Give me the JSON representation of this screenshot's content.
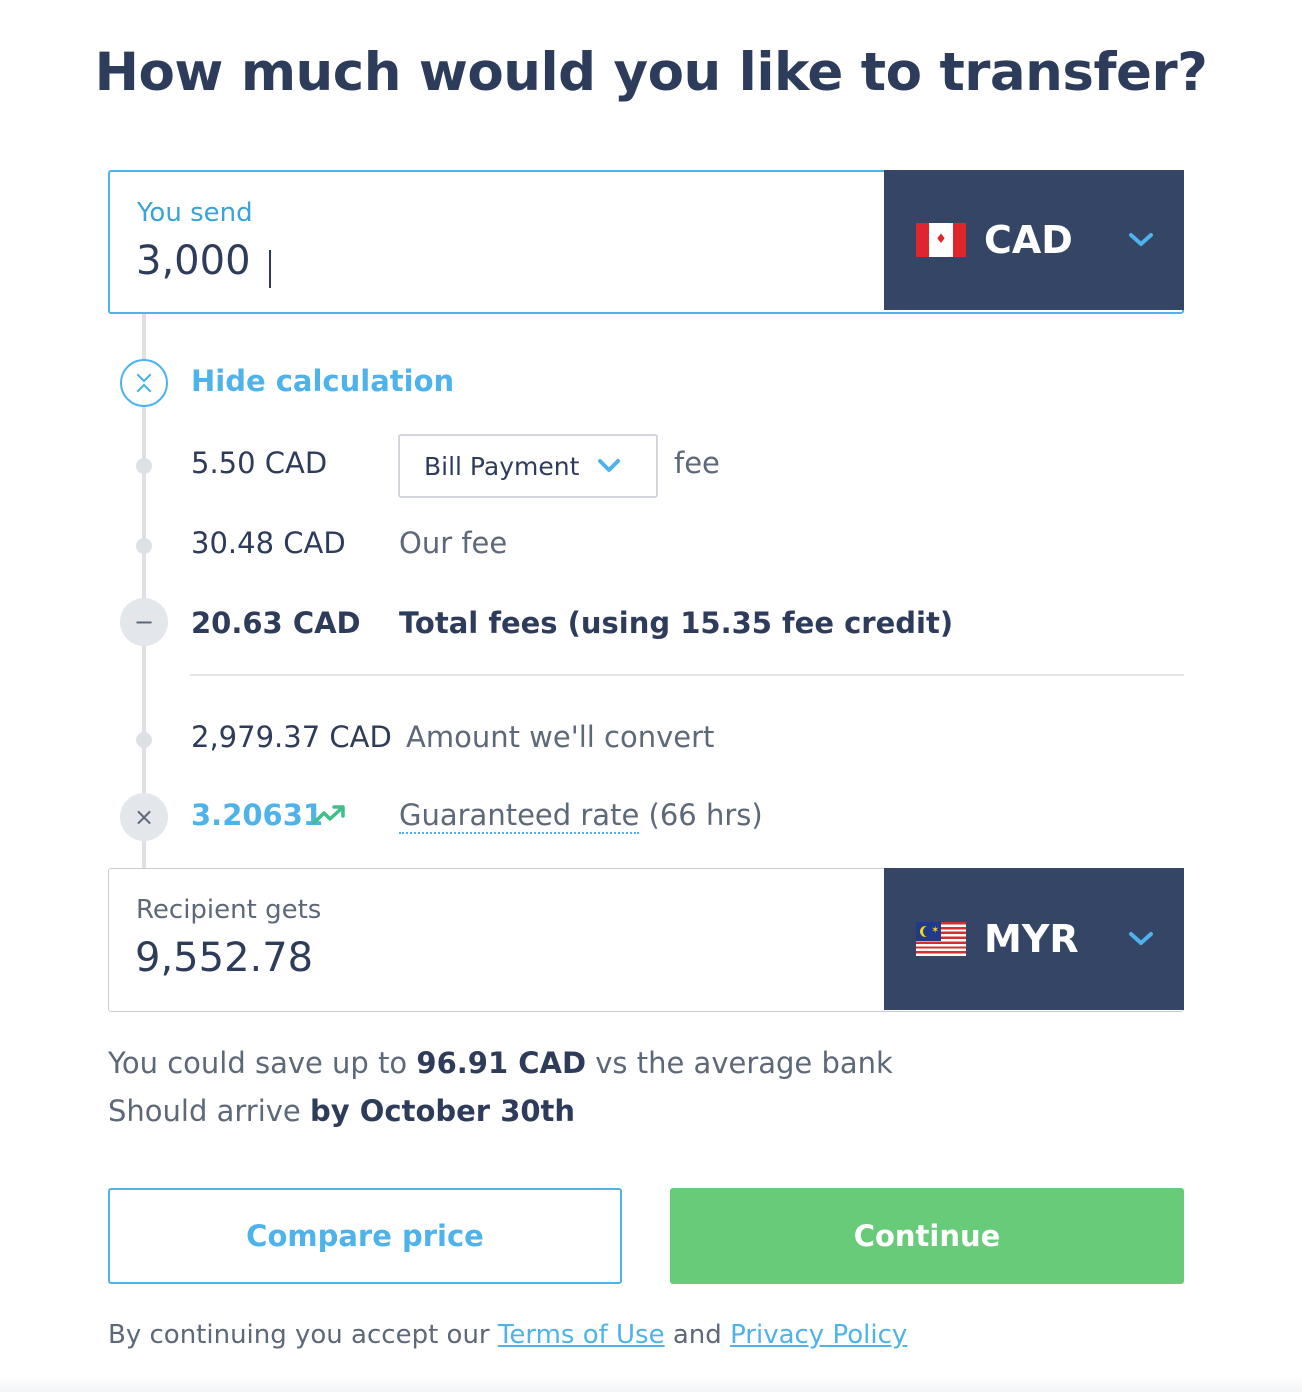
{
  "title": "How much would you like to transfer?",
  "send": {
    "label": "You send",
    "value": "3,000",
    "currency": "CAD",
    "flag_icon": "canada-flag-icon"
  },
  "calculation": {
    "toggle_label": "Hide calculation",
    "rows": {
      "payment_fee_amount": "5.50 CAD",
      "payment_method": "Bill Payment",
      "payment_fee_suffix": "fee",
      "our_fee_amount": "30.48 CAD",
      "our_fee_label": "Our fee",
      "total_fees_amount": "20.63 CAD",
      "total_fees_label": "Total fees (using 15.35 fee credit)",
      "convert_amount": "2,979.37 CAD",
      "convert_label": "Amount we'll convert",
      "rate": "3.20631",
      "rate_link": "Guaranteed rate",
      "rate_hours": "(66 hrs)"
    }
  },
  "receive": {
    "label": "Recipient gets",
    "value": "9,552.78",
    "currency": "MYR",
    "flag_icon": "malaysia-flag-icon"
  },
  "summary": {
    "save_prefix": "You could save up to",
    "save_amount": "96.91 CAD",
    "save_suffix": "vs the average bank",
    "arrive_prefix": "Should arrive",
    "arrive_date": "by October 30th"
  },
  "buttons": {
    "compare": "Compare price",
    "continue": "Continue"
  },
  "legal": {
    "prefix": "By continuing you accept our",
    "terms": "Terms of Use",
    "and": "and",
    "privacy": "Privacy Policy"
  },
  "colors": {
    "accent_blue": "#4eb3ea",
    "navy": "#344566",
    "green": "#67cb79",
    "trend_green": "#3fbf8a"
  }
}
